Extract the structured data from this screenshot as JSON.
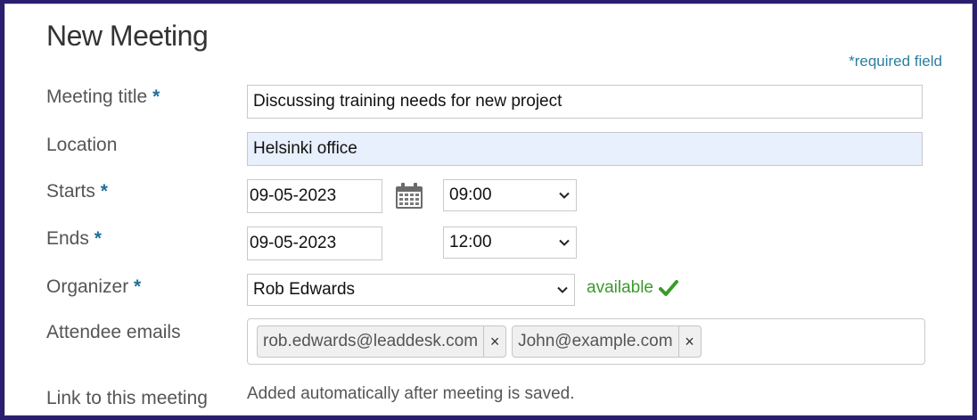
{
  "form": {
    "title": "New Meeting",
    "required_note": "*required field",
    "required_star": "*",
    "meeting_title": {
      "label": "Meeting title",
      "value": "Discussing training needs for new project"
    },
    "location": {
      "label": "Location",
      "value": "Helsinki office"
    },
    "starts": {
      "label": "Starts",
      "date": "09-05-2023",
      "time": "09:00"
    },
    "ends": {
      "label": "Ends",
      "date": "09-05-2023",
      "time": "12:00"
    },
    "organizer": {
      "label": "Organizer",
      "value": "Rob Edwards",
      "status": "available"
    },
    "attendees": {
      "label": "Attendee emails",
      "emails": [
        "rob.edwards@leaddesk.com",
        "John@example.com"
      ],
      "remove_glyph": "×"
    },
    "link": {
      "label": "Link to this meeting",
      "value": "Added automatically after meeting is saved."
    }
  },
  "colors": {
    "accent": "#1f6f9a",
    "available": "#3a9a2a",
    "focused_bg": "#e8effd",
    "frame": "#2a1f6e"
  },
  "icons": {
    "calendar": "calendar-icon",
    "chevron": "chevron-down-icon",
    "check": "check-icon"
  }
}
